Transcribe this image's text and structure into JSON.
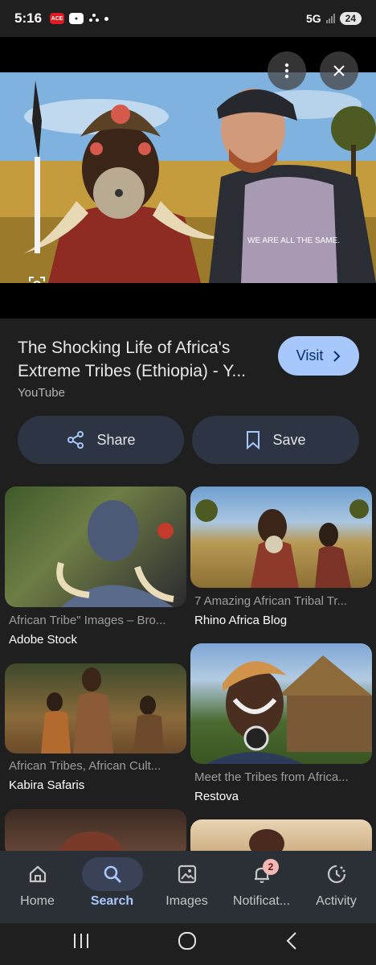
{
  "status": {
    "time": "5:16",
    "network": "5G",
    "battery": "24",
    "app_icons": [
      "ace-icon",
      "news-icon",
      "pinwheel-icon",
      "dot-icon"
    ]
  },
  "result": {
    "title": "The Shocking Life of Africa's Extreme Tribes (Ethiopia) - Y...",
    "source": "YouTube",
    "visit_label": "Visit",
    "share_label": "Share",
    "save_label": "Save"
  },
  "related": [
    {
      "caption": "African Tribe\" Images – Bro...",
      "source": "Adobe Stock"
    },
    {
      "caption": "7 Amazing African Tribal Tr...",
      "source": "Rhino Africa Blog"
    },
    {
      "caption": "African Tribes, African Cult...",
      "source": "Kabira Safaris"
    },
    {
      "caption": "Meet the Tribes from Africa...",
      "source": "Restova"
    }
  ],
  "nav": {
    "items": [
      {
        "label": "Home",
        "icon": "home-icon"
      },
      {
        "label": "Search",
        "icon": "search-icon"
      },
      {
        "label": "Images",
        "icon": "images-icon"
      },
      {
        "label": "Notificat...",
        "icon": "bell-icon"
      },
      {
        "label": "Activity",
        "icon": "activity-icon"
      }
    ],
    "badge_count": "2",
    "active": "Search"
  },
  "colors": {
    "background": "#1f1f1f",
    "accent": "#a8c7fa",
    "button_bg": "#2d3444",
    "nav_bg": "#2b2f36"
  }
}
